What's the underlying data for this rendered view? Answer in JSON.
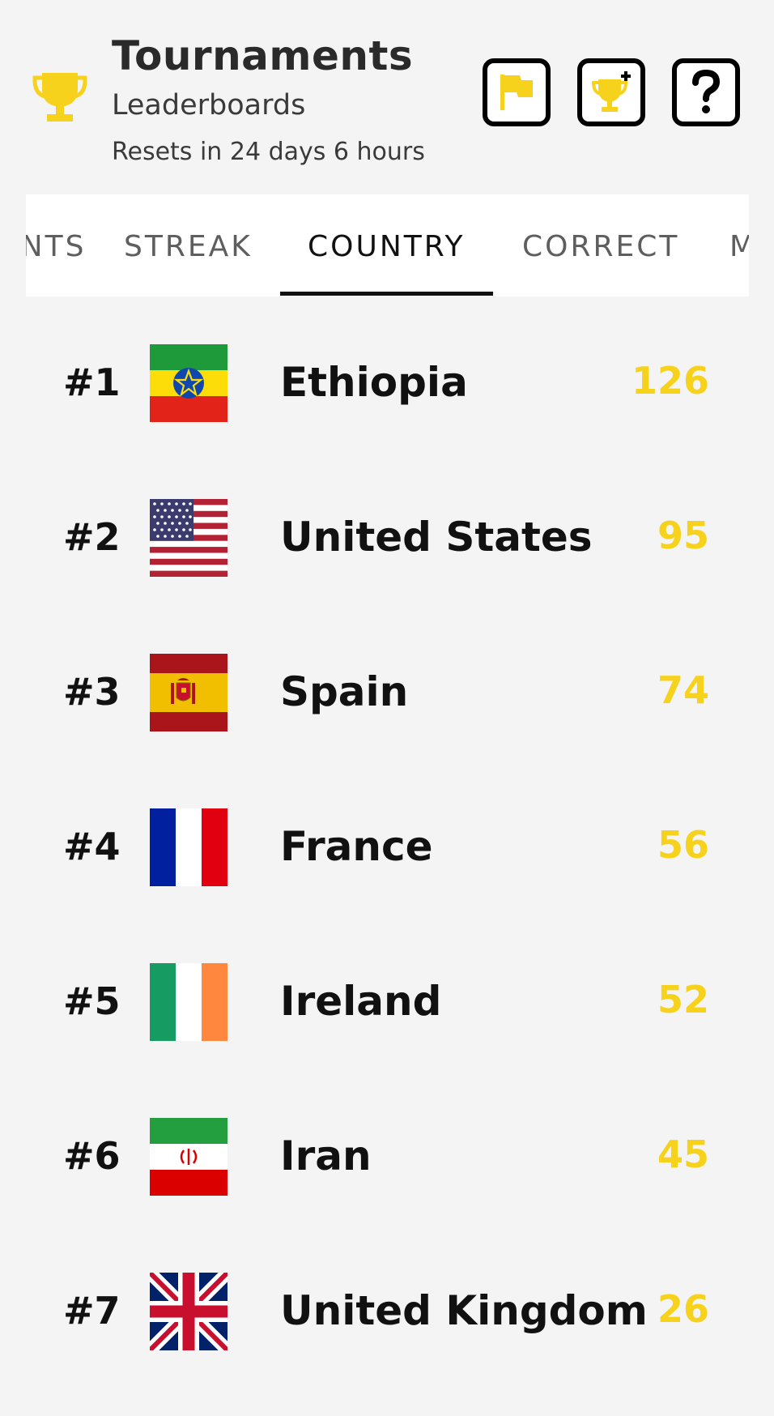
{
  "header": {
    "title": "Tournaments",
    "subtitle": "Leaderboards",
    "resets": "Resets in 24 days 6 hours",
    "icons": [
      "trophy-icon",
      "flag-icon",
      "trophy-plus-icon",
      "question-icon"
    ]
  },
  "tabs": [
    {
      "label": "POINTS",
      "active": false
    },
    {
      "label": "STREAK",
      "active": false
    },
    {
      "label": "COUNTRY",
      "active": true
    },
    {
      "label": "CORRECT",
      "active": false
    },
    {
      "label": "MOST",
      "active": false
    }
  ],
  "leaderboard": [
    {
      "rank": "#1",
      "country": "Ethiopia",
      "score": "126",
      "flag": "ethiopia-flag-icon"
    },
    {
      "rank": "#2",
      "country": "United States",
      "score": "95",
      "flag": "usa-flag-icon"
    },
    {
      "rank": "#3",
      "country": "Spain",
      "score": "74",
      "flag": "spain-flag-icon"
    },
    {
      "rank": "#4",
      "country": "France",
      "score": "56",
      "flag": "france-flag-icon"
    },
    {
      "rank": "#5",
      "country": "Ireland",
      "score": "52",
      "flag": "ireland-flag-icon"
    },
    {
      "rank": "#6",
      "country": "Iran",
      "score": "45",
      "flag": "iran-flag-icon"
    },
    {
      "rank": "#7",
      "country": "United Kingdom",
      "score": "26",
      "flag": "uk-flag-icon"
    }
  ],
  "colors": {
    "accent": "#f7d21c",
    "background": "#f4f4f5",
    "text": "#111111"
  }
}
